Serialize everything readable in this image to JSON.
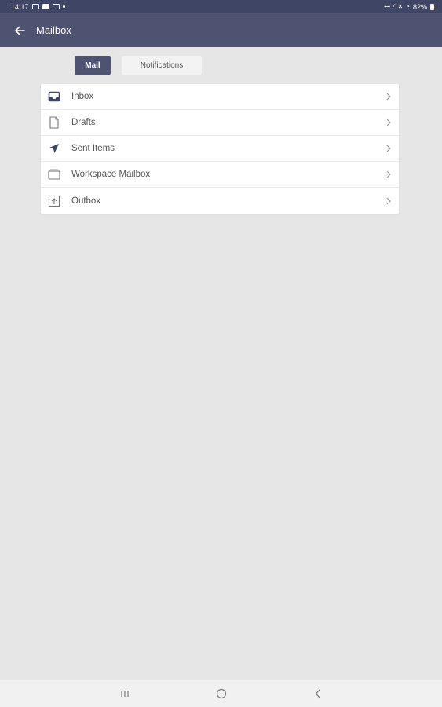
{
  "status_bar": {
    "time": "14:17",
    "battery": "82%"
  },
  "app_bar": {
    "title": "Mailbox",
    "back_icon": "arrow-left-icon"
  },
  "tabs": [
    {
      "label": "Mail",
      "active": true
    },
    {
      "label": "Notifications",
      "active": false
    }
  ],
  "mail_folders": [
    {
      "label": "Inbox",
      "icon": "inbox-tray-icon"
    },
    {
      "label": "Drafts",
      "icon": "document-icon"
    },
    {
      "label": "Sent Items",
      "icon": "paper-plane-icon"
    },
    {
      "label": "Workspace Mailbox",
      "icon": "mailbox-icon"
    },
    {
      "label": "Outbox",
      "icon": "outbox-upload-icon"
    }
  ],
  "nav_bar": {
    "recents_icon": "recents-icon",
    "home_icon": "home-circle-icon",
    "back_icon": "nav-back-icon"
  },
  "colors": {
    "status_bar": "#3f4565",
    "app_bar": "#4e5372",
    "background": "#e6e6e6",
    "accent": "#4e5372"
  }
}
